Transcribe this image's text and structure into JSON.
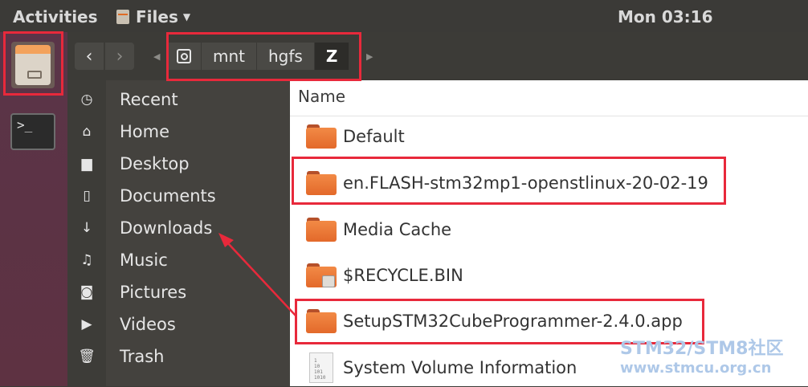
{
  "topbar": {
    "activities": "Activities",
    "app_name": "Files",
    "clock": "Mon 03:16"
  },
  "launcher": {
    "items": [
      "files-icon",
      "terminal-icon"
    ],
    "terminal_glyph": ">_"
  },
  "toolbar": {
    "back": "‹",
    "forward": "›",
    "path": [
      "mnt",
      "hgfs",
      "Z"
    ]
  },
  "sidebar": {
    "items": [
      {
        "label": "Recent",
        "icon": "clock-icon"
      },
      {
        "label": "Home",
        "icon": "home-icon"
      },
      {
        "label": "Desktop",
        "icon": "desktop-folder-icon"
      },
      {
        "label": "Documents",
        "icon": "document-icon"
      },
      {
        "label": "Downloads",
        "icon": "download-icon"
      },
      {
        "label": "Music",
        "icon": "music-icon"
      },
      {
        "label": "Pictures",
        "icon": "camera-icon"
      },
      {
        "label": "Videos",
        "icon": "video-icon"
      },
      {
        "label": "Trash",
        "icon": "trash-icon"
      }
    ]
  },
  "files": {
    "column_name": "Name",
    "rows": [
      {
        "name": "Default",
        "type": "folder"
      },
      {
        "name": "en.FLASH-stm32mp1-openstlinux-20-02-19",
        "type": "folder"
      },
      {
        "name": "Media Cache",
        "type": "folder"
      },
      {
        "name": "$RECYCLE.BIN",
        "type": "folder-locked"
      },
      {
        "name": "SetupSTM32CubeProgrammer-2.4.0.app",
        "type": "folder"
      },
      {
        "name": "System Volume Information",
        "type": "file"
      }
    ],
    "file_glyph_lines": [
      "1",
      "10",
      "101",
      "1010"
    ]
  },
  "watermark": {
    "line1": "STM32/STM8社区",
    "line2": "www.stmcu.org.cn"
  },
  "colors": {
    "annotation": "#e8293b",
    "folder": "#e3692a",
    "launcher": "#5a3448"
  }
}
